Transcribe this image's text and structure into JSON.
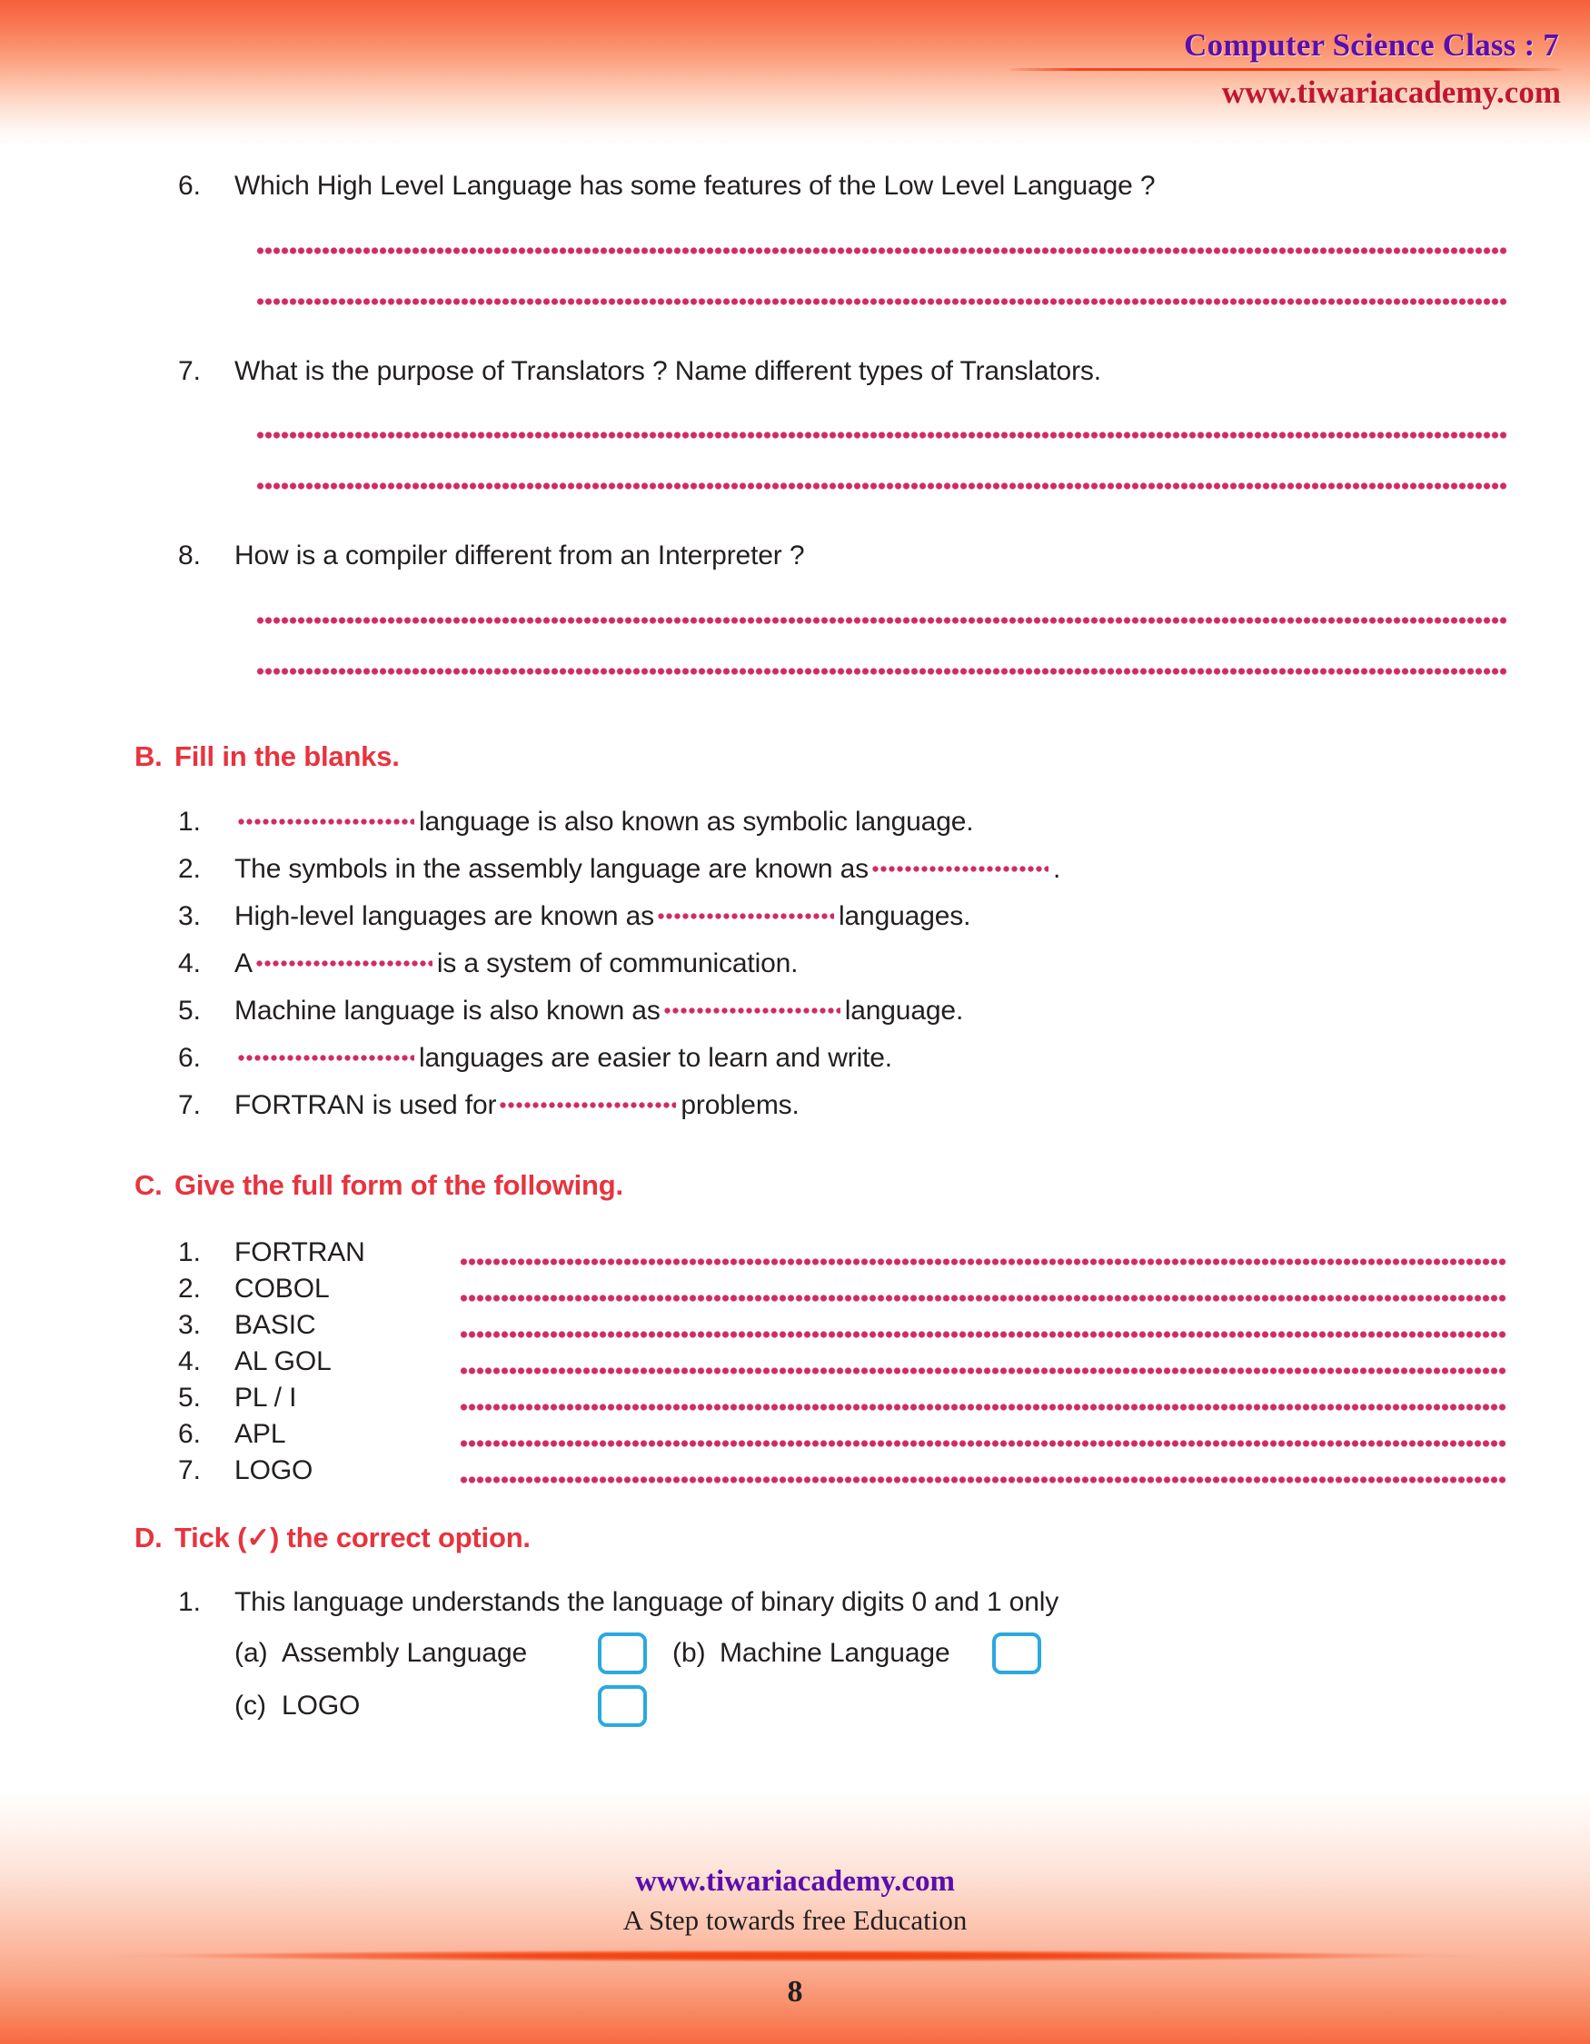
{
  "header": {
    "title": "Computer Science Class : 7",
    "site": "www.tiwariacademy.com"
  },
  "section_a": {
    "questions": [
      {
        "num": "6.",
        "text": "Which High Level Language has some features of the Low Level Language ?"
      },
      {
        "num": "7.",
        "text": "What is the purpose of Translators ? Name different types of Translators."
      },
      {
        "num": "8.",
        "text": "How is a compiler different from an Interpreter ?"
      }
    ]
  },
  "section_b": {
    "letter": "B.",
    "title": "Fill in the blanks.",
    "items": [
      {
        "num": "1.",
        "before": "",
        "after": "language is also known as symbolic language."
      },
      {
        "num": "2.",
        "before": "The symbols in the assembly language are known as",
        "after": "."
      },
      {
        "num": "3.",
        "before": "High-level languages are known as",
        "after": "languages."
      },
      {
        "num": "4.",
        "before": "A",
        "after": "is a system of communication."
      },
      {
        "num": "5.",
        "before": "Machine language is also known as",
        "after": "language."
      },
      {
        "num": "6.",
        "before": "",
        "after": "languages are easier to learn and write."
      },
      {
        "num": "7.",
        "before": "FORTRAN is used for",
        "after": "problems."
      }
    ]
  },
  "section_c": {
    "letter": "C.",
    "title": "Give the full form of the following.",
    "items": [
      {
        "num": "1.",
        "label": "FORTRAN"
      },
      {
        "num": "2.",
        "label": "COBOL"
      },
      {
        "num": "3.",
        "label": "BASIC"
      },
      {
        "num": "4.",
        "label": "AL GOL"
      },
      {
        "num": "5.",
        "label": "PL / I"
      },
      {
        "num": "6.",
        "label": "APL"
      },
      {
        "num": "7.",
        "label": "LOGO"
      }
    ]
  },
  "section_d": {
    "letter": "D.",
    "title": "Tick (✓) the correct option.",
    "question": {
      "num": "1.",
      "text": "This language understands the language of binary digits 0 and 1 only"
    },
    "options": [
      {
        "key": "(a)",
        "label": "Assembly Language"
      },
      {
        "key": "(b)",
        "label": "Machine Language"
      },
      {
        "key": "(c)",
        "label": "LOGO"
      }
    ]
  },
  "footer": {
    "site": "www.tiwariacademy.com",
    "tagline": "A Step towards free Education",
    "page_number": "8"
  },
  "colors": {
    "title_purple": "#5b0ead",
    "site_red": "#c3162c",
    "heading_red": "#e8333e",
    "dot_pink": "#cf2d62",
    "checkbox_blue": "#2ba8e0",
    "band_orange": "#f75f3c"
  }
}
